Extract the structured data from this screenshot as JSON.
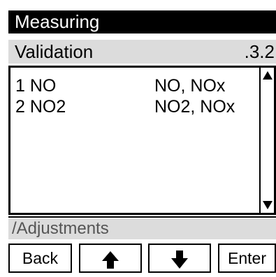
{
  "header": {
    "title": "Measuring"
  },
  "subheader": {
    "label": "Validation",
    "code": ".3.2"
  },
  "list": {
    "items": [
      {
        "name": "1 NO",
        "components": "NO, NOx"
      },
      {
        "name": "2 NO2",
        "components": "NO2, NOx"
      }
    ]
  },
  "scrollbar": {
    "up_icon": "triangle-up-icon",
    "down_icon": "triangle-down-icon"
  },
  "footer": {
    "path": "/Adjustments"
  },
  "softkeys": {
    "back_label": "Back",
    "up_icon": "arrow-up-icon",
    "down_icon": "arrow-down-icon",
    "enter_label": "Enter"
  },
  "colors": {
    "title_background": "#000000",
    "bar_background": "#dcdcdc",
    "path_text": "#555555"
  }
}
